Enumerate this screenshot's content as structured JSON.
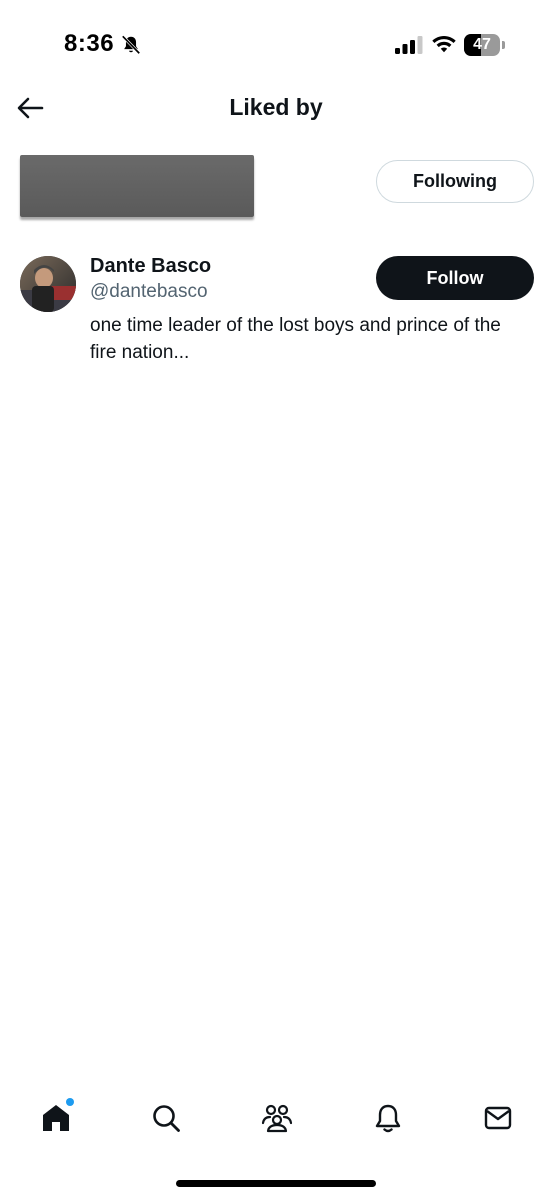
{
  "status_bar": {
    "time": "8:36",
    "battery_level": "47",
    "battery_fraction": 0.47,
    "icons": [
      "bell-slash-icon",
      "cellular-signal-icon",
      "wifi-icon",
      "battery-icon"
    ]
  },
  "header": {
    "title": "Liked by",
    "back_icon": "arrow-left-icon"
  },
  "users": [
    {
      "redacted": true,
      "button_label": "Following"
    },
    {
      "name": "Dante Basco",
      "handle": "@dantebasco",
      "bio": "one time leader of the lost boys and prince of the fire nation...",
      "button_label": "Follow"
    }
  ],
  "bottom_nav": {
    "items": [
      "home-icon",
      "search-icon",
      "communities-icon",
      "notifications-icon",
      "messages-icon"
    ],
    "active": "home-icon",
    "notification_dot_color": "#1d9bf0"
  },
  "colors": {
    "text_primary": "#0f1419",
    "text_secondary": "#536471",
    "follow_button_bg": "#0f1419",
    "following_button_border": "#cfd9de",
    "accent": "#1d9bf0"
  }
}
